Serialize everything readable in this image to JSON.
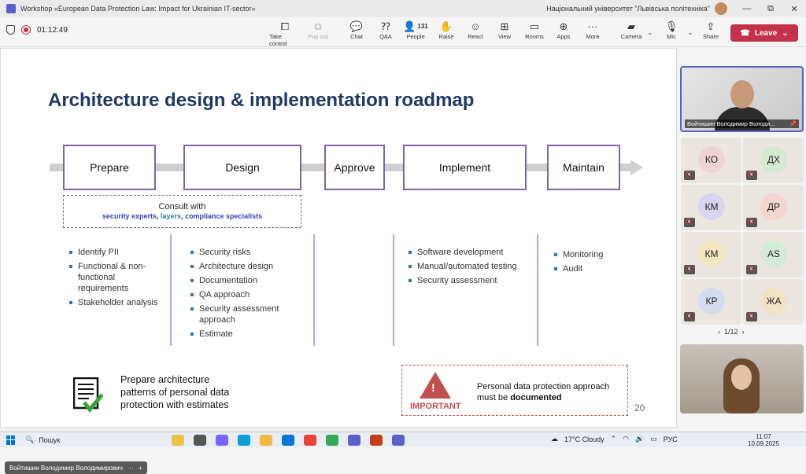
{
  "window": {
    "title": "Workshop «European Data Protection Law: Impact for Ukrainian IT-sector»",
    "org": "Національний університет \"Львівська політехніка\"",
    "min": "—",
    "restore": "⧉",
    "close": "✕"
  },
  "meeting": {
    "timer": "01:12:49"
  },
  "toolbar": {
    "take_control": "Take control",
    "pop_out": "Pop out",
    "chat": "Chat",
    "qa": "Q&A",
    "people": "People",
    "people_count": "131",
    "raise": "Raise",
    "react": "React",
    "view": "View",
    "rooms": "Rooms",
    "apps": "Apps",
    "more": "More",
    "camera": "Camera",
    "mic": "Mic",
    "share": "Share",
    "leave": "Leave"
  },
  "slide": {
    "title": "Architecture design & implementation roadmap",
    "stages": [
      "Prepare",
      "Design",
      "Approve",
      "Implement",
      "Maintain"
    ],
    "consult": {
      "line1": "Consult with",
      "experts": "security experts",
      "sep1": ", ",
      "layers": "layers",
      "sep2": ", ",
      "specialists": "compliance specialists"
    },
    "prepare_items": [
      "Identify PII",
      "Functional & non-functional requirements",
      "Stakeholder analysis"
    ],
    "design_items": [
      "Security risks",
      "Architecture design",
      "Documentation",
      "QA approach",
      "Security assessment approach",
      "Estimate"
    ],
    "implement_items": [
      "Software development",
      "Manual/automated testing",
      "Security assessment"
    ],
    "maintain_items": [
      "Monitoring",
      "Audit"
    ],
    "footer_note": "Prepare architecture patterns of personal data protection with estimates",
    "important_label": "IMPORTANT",
    "important_text_1": "Personal data protection approach must be ",
    "important_text_2": "documented",
    "page_number": "20"
  },
  "presenter_chip": "Войтишин Володимир Володимирович",
  "self_video_name": "Войтишин Володимир Володи...",
  "participants": [
    {
      "initials": "КО",
      "color": "#f0d4d4"
    },
    {
      "initials": "ДХ",
      "color": "#d7e8d4"
    },
    {
      "initials": "КМ",
      "color": "#d9d4ef"
    },
    {
      "initials": "ДР",
      "color": "#f3d6d0"
    },
    {
      "initials": "КМ",
      "color": "#f3e6c2"
    },
    {
      "initials": "AS",
      "color": "#d4ebd8"
    },
    {
      "initials": "КР",
      "color": "#d4dcef"
    },
    {
      "initials": "ЖА",
      "color": "#f3e2c4"
    }
  ],
  "pager": "1/12",
  "taskbar": {
    "search": "Пошук",
    "weather": "17°C  Cloudy",
    "lang": "РУС",
    "time": "11:07",
    "date": "10.09.2025"
  }
}
